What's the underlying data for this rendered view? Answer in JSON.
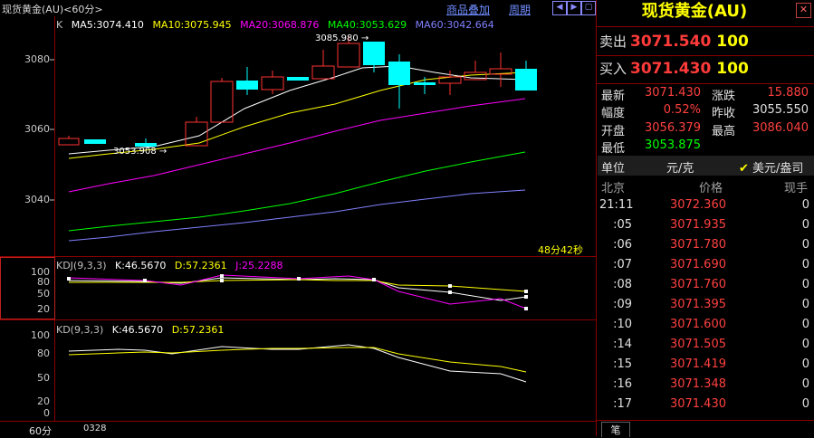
{
  "header": {
    "title": "现货黄金(AU)<60分>",
    "menu_overlay": "商品叠加",
    "menu_period": "周期"
  },
  "ma_legend": {
    "prefix": "K",
    "ma5": "MA5:3074.410",
    "ma10": "MA10:3075.945",
    "ma20": "MA20:3068.876",
    "ma40": "MA40:3053.629",
    "ma60": "MA60:3042.664"
  },
  "colors": {
    "ma5": "#ffffff",
    "ma10": "#ffff00",
    "ma20": "#ff00ff",
    "ma40": "#00ff00",
    "ma60": "#8080ff",
    "up": "#ff3232",
    "down": "#00ffff",
    "grid": "#8b0000"
  },
  "price_axis": [
    "3080",
    "3060",
    "3040"
  ],
  "annotations": {
    "high": "3085.980",
    "low": "3053.908",
    "countdown": "48分42秒"
  },
  "kdj_legend": {
    "name": "KDJ(9,3,3)",
    "k": "K:46.5670",
    "d": "D:57.2361",
    "j": "J:25.2288"
  },
  "kdj_axis": [
    "100",
    "80",
    "50",
    "20"
  ],
  "kd_legend": {
    "name": "KD(9,3,3)",
    "k": "K:46.5670",
    "d": "D:57.2361"
  },
  "kd_axis": [
    "100",
    "80",
    "50",
    "20",
    "0"
  ],
  "bottom": {
    "period": "60分",
    "date": "0328"
  },
  "quote_panel": {
    "title": "现货黄金(AU)",
    "sell_label": "卖出",
    "sell_price": "3071.540",
    "sell_volume": "100",
    "buy_label": "买入",
    "buy_price": "3071.430",
    "buy_volume": "100",
    "rows": [
      {
        "l1": "最新",
        "v1": "3071.430",
        "l2": "涨跌",
        "v2": "15.880"
      },
      {
        "l1": "幅度",
        "v1": "0.52%",
        "l2": "昨收",
        "v2": "3055.550"
      },
      {
        "l1": "开盘",
        "v1": "3056.379",
        "l2": "最高",
        "v2": "3086.040"
      },
      {
        "l1": "最低",
        "v1": "3053.875",
        "l2": "",
        "v2": ""
      }
    ],
    "unit_label": "单位",
    "unit_value": "元/克",
    "unit_option": "美元/盎司",
    "col_place": "北京",
    "col_price": "价格",
    "col_volume": "现手",
    "ticks": [
      {
        "t": "21:11",
        "p": "3072.360",
        "v": "0"
      },
      {
        "t": ":05",
        "p": "3071.935",
        "v": "0"
      },
      {
        "t": ":06",
        "p": "3071.780",
        "v": "0"
      },
      {
        "t": ":07",
        "p": "3071.690",
        "v": "0"
      },
      {
        "t": ":08",
        "p": "3071.760",
        "v": "0"
      },
      {
        "t": ":09",
        "p": "3071.395",
        "v": "0"
      },
      {
        "t": ":10",
        "p": "3071.600",
        "v": "0"
      },
      {
        "t": ":14",
        "p": "3071.505",
        "v": "0"
      },
      {
        "t": ":15",
        "p": "3071.419",
        "v": "0"
      },
      {
        "t": ":16",
        "p": "3071.348",
        "v": "0"
      },
      {
        "t": ":17",
        "p": "3071.430",
        "v": "0"
      }
    ],
    "tab_label": "笔"
  }
}
